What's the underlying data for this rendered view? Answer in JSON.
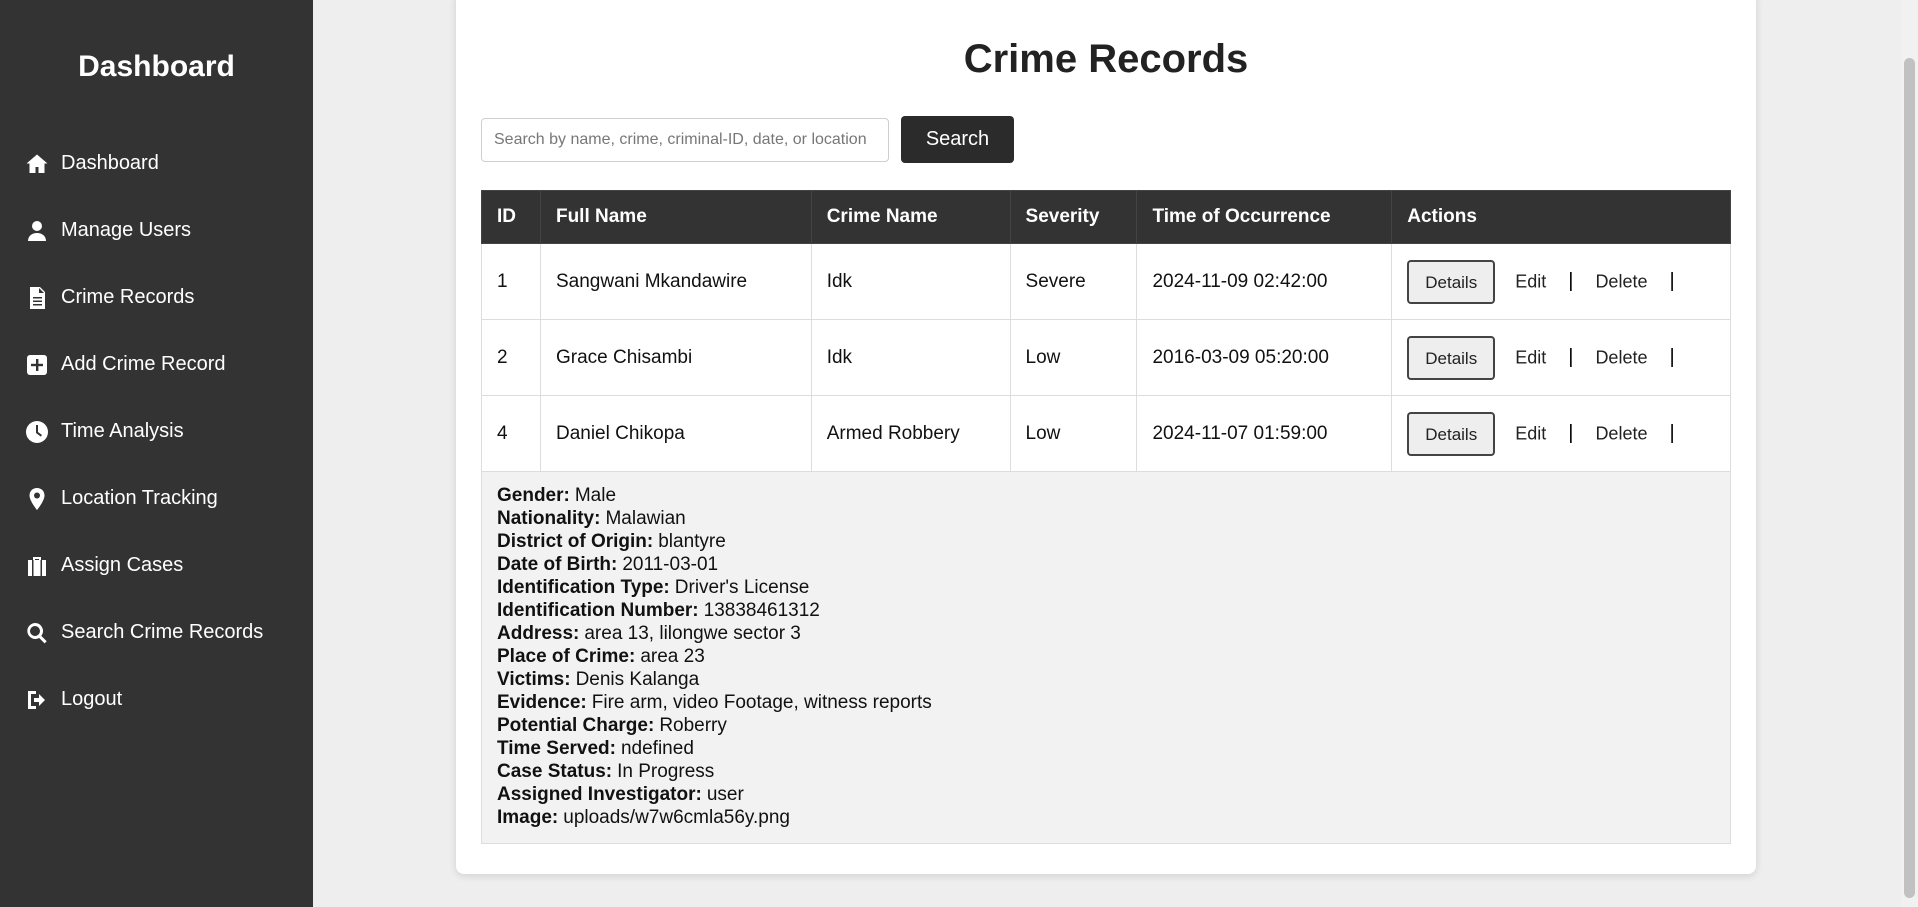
{
  "sidebar": {
    "title": "Dashboard",
    "items": [
      {
        "label": "Dashboard",
        "icon": "home-icon"
      },
      {
        "label": "Manage Users",
        "icon": "user-icon"
      },
      {
        "label": "Crime Records",
        "icon": "document-icon"
      },
      {
        "label": "Add Crime Record",
        "icon": "plus-square-icon"
      },
      {
        "label": "Time Analysis",
        "icon": "clock-icon"
      },
      {
        "label": "Location Tracking",
        "icon": "map-pin-icon"
      },
      {
        "label": "Assign Cases",
        "icon": "briefcase-icon"
      },
      {
        "label": "Search Crime Records",
        "icon": "search-icon"
      },
      {
        "label": "Logout",
        "icon": "logout-icon"
      }
    ]
  },
  "main": {
    "title": "Crime Records",
    "search": {
      "placeholder": "Search by name, crime, criminal-ID, date, or location",
      "value": "",
      "button_label": "Search"
    },
    "table": {
      "columns": [
        "ID",
        "Full Name",
        "Crime Name",
        "Severity",
        "Time of Occurrence",
        "Actions"
      ],
      "rows": [
        {
          "id": "1",
          "full_name": "Sangwani Mkandawire",
          "crime_name": "Idk",
          "severity": "Severe",
          "time": "2024-11-09 02:42:00"
        },
        {
          "id": "2",
          "full_name": "Grace Chisambi",
          "crime_name": "Idk",
          "severity": "Low",
          "time": "2016-03-09 05:20:00"
        },
        {
          "id": "4",
          "full_name": "Daniel Chikopa",
          "crime_name": "Armed Robbery",
          "severity": "Low",
          "time": "2024-11-07 01:59:00"
        }
      ],
      "actions": {
        "details": "Details",
        "edit": "Edit",
        "delete": "Delete",
        "separator": "|"
      }
    },
    "details": [
      {
        "label": "Gender:",
        "value": "Male"
      },
      {
        "label": "Nationality:",
        "value": "Malawian"
      },
      {
        "label": "District of Origin:",
        "value": "blantyre"
      },
      {
        "label": "Date of Birth:",
        "value": "2011-03-01"
      },
      {
        "label": "Identification Type:",
        "value": "Driver's License"
      },
      {
        "label": "Identification Number:",
        "value": "13838461312"
      },
      {
        "label": "Address:",
        "value": "area 13, lilongwe sector 3"
      },
      {
        "label": "Place of Crime:",
        "value": "area 23"
      },
      {
        "label": "Victims:",
        "value": "Denis Kalanga"
      },
      {
        "label": "Evidence:",
        "value": "Fire arm, video Footage, witness reports"
      },
      {
        "label": "Potential Charge:",
        "value": "Roberry"
      },
      {
        "label": "Time Served:",
        "value": "ndefined"
      },
      {
        "label": "Case Status:",
        "value": "In Progress"
      },
      {
        "label": "Assigned Investigator:",
        "value": "user"
      },
      {
        "label": "Image:",
        "value": "uploads/w7w6cmla56y.png"
      }
    ]
  }
}
